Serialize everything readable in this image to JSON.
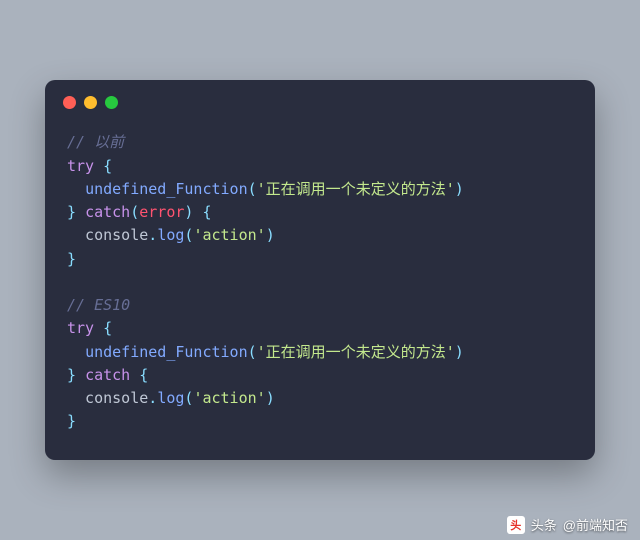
{
  "window": {
    "traffic_lights": [
      "red",
      "yellow",
      "green"
    ]
  },
  "code": {
    "lines": [
      {
        "tokens": [
          {
            "t": "comment",
            "v": "// 以前"
          }
        ]
      },
      {
        "tokens": [
          {
            "t": "kw",
            "v": "try"
          },
          {
            "t": "ident",
            "v": " "
          },
          {
            "t": "punc",
            "v": "{"
          }
        ]
      },
      {
        "tokens": [
          {
            "t": "ident",
            "v": "  "
          },
          {
            "t": "fn",
            "v": "undefined_Function"
          },
          {
            "t": "punc",
            "v": "("
          },
          {
            "t": "str",
            "v": "'正在调用一个未定义的方法'"
          },
          {
            "t": "punc",
            "v": ")"
          }
        ]
      },
      {
        "tokens": [
          {
            "t": "punc",
            "v": "} "
          },
          {
            "t": "kw",
            "v": "catch"
          },
          {
            "t": "punc",
            "v": "("
          },
          {
            "t": "err",
            "v": "error"
          },
          {
            "t": "punc",
            "v": ") {"
          }
        ]
      },
      {
        "tokens": [
          {
            "t": "ident",
            "v": "  console"
          },
          {
            "t": "punc",
            "v": "."
          },
          {
            "t": "fn",
            "v": "log"
          },
          {
            "t": "punc",
            "v": "("
          },
          {
            "t": "str",
            "v": "'action'"
          },
          {
            "t": "punc",
            "v": ")"
          }
        ]
      },
      {
        "tokens": [
          {
            "t": "punc",
            "v": "}"
          }
        ]
      },
      {
        "tokens": [
          {
            "t": "ident",
            "v": " "
          }
        ]
      },
      {
        "tokens": [
          {
            "t": "comment",
            "v": "// ES10"
          }
        ]
      },
      {
        "tokens": [
          {
            "t": "kw",
            "v": "try"
          },
          {
            "t": "ident",
            "v": " "
          },
          {
            "t": "punc",
            "v": "{"
          }
        ]
      },
      {
        "tokens": [
          {
            "t": "ident",
            "v": "  "
          },
          {
            "t": "fn",
            "v": "undefined_Function"
          },
          {
            "t": "punc",
            "v": "("
          },
          {
            "t": "str",
            "v": "'正在调用一个未定义的方法'"
          },
          {
            "t": "punc",
            "v": ")"
          }
        ]
      },
      {
        "tokens": [
          {
            "t": "punc",
            "v": "} "
          },
          {
            "t": "kw",
            "v": "catch"
          },
          {
            "t": "ident",
            "v": " "
          },
          {
            "t": "punc",
            "v": "{"
          }
        ]
      },
      {
        "tokens": [
          {
            "t": "ident",
            "v": "  console"
          },
          {
            "t": "punc",
            "v": "."
          },
          {
            "t": "fn",
            "v": "log"
          },
          {
            "t": "punc",
            "v": "("
          },
          {
            "t": "str",
            "v": "'action'"
          },
          {
            "t": "punc",
            "v": ")"
          }
        ]
      },
      {
        "tokens": [
          {
            "t": "punc",
            "v": "}"
          }
        ]
      }
    ]
  },
  "watermark": {
    "badge": "头",
    "prefix": "头条",
    "handle": "@前端知否"
  }
}
